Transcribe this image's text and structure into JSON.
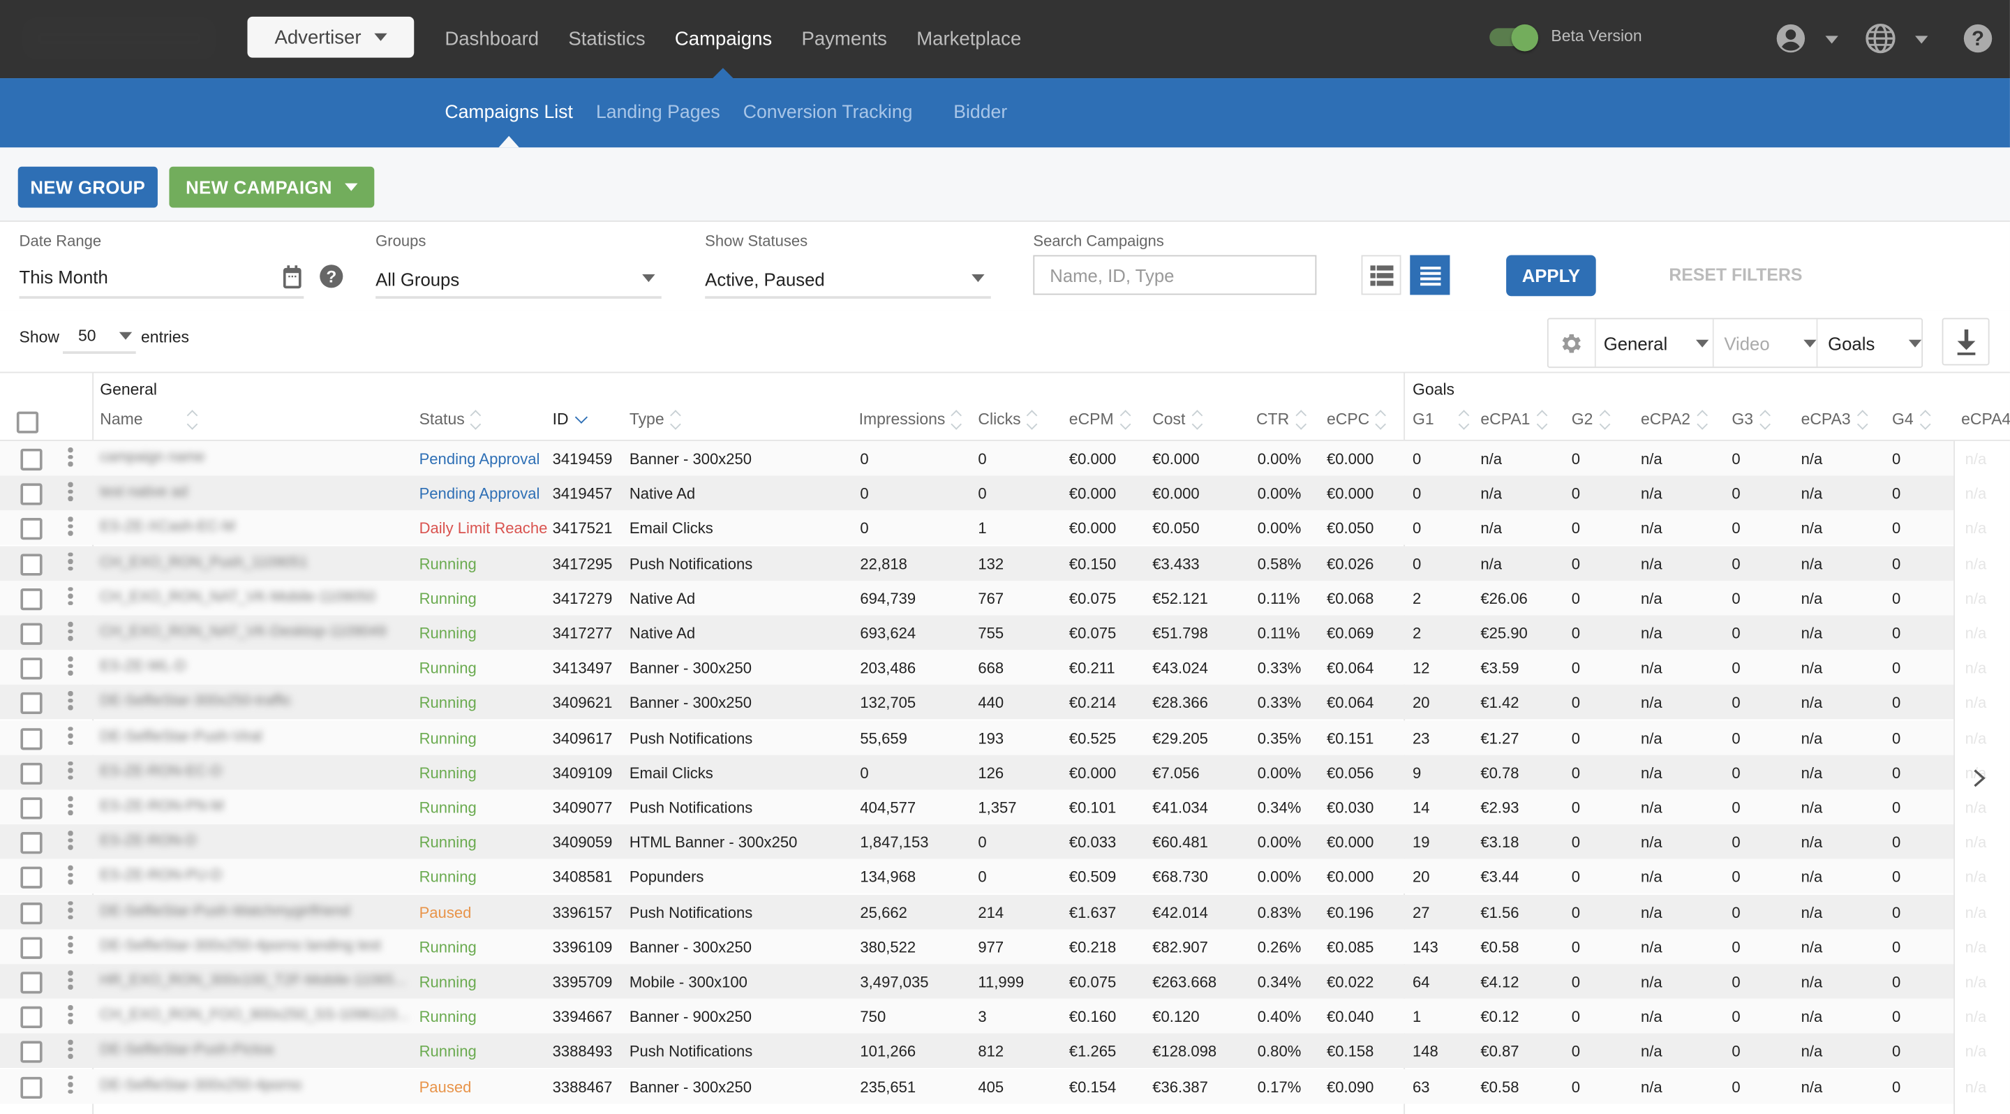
{
  "topnav": {
    "role_selector": "Advertiser",
    "items": [
      {
        "label": "Dashboard",
        "active": false
      },
      {
        "label": "Statistics",
        "active": false
      },
      {
        "label": "Campaigns",
        "active": true
      },
      {
        "label": "Payments",
        "active": false
      },
      {
        "label": "Marketplace",
        "active": false
      }
    ],
    "beta_label": "Beta Version",
    "beta_enabled": true
  },
  "subnav": {
    "items": [
      {
        "label": "Campaigns List",
        "active": true
      },
      {
        "label": "Landing Pages",
        "active": false
      },
      {
        "label": "Conversion Tracking",
        "active": false
      },
      {
        "label": "Bidder",
        "active": false
      }
    ]
  },
  "actions": {
    "new_group": "NEW GROUP",
    "new_campaign": "NEW CAMPAIGN"
  },
  "filters": {
    "date_range_label": "Date Range",
    "date_range_value": "This Month",
    "groups_label": "Groups",
    "groups_value": "All Groups",
    "statuses_label": "Show Statuses",
    "statuses_value": "Active, Paused",
    "search_label": "Search Campaigns",
    "search_placeholder": "Name, ID, Type",
    "search_value": "",
    "apply": "APPLY",
    "reset": "RESET FILTERS"
  },
  "entries": {
    "show": "Show",
    "count": "50",
    "suffix": "entries"
  },
  "column_sets": {
    "general": "General",
    "video": "Video",
    "goals": "Goals"
  },
  "table": {
    "group_general": "General",
    "group_goals": "Goals",
    "columns": {
      "name": "Name",
      "status": "Status",
      "id": "ID",
      "type": "Type",
      "impressions": "Impressions",
      "clicks": "Clicks",
      "ecpm": "eCPM",
      "cost": "Cost",
      "ctr": "CTR",
      "ecpc": "eCPC",
      "g1": "G1",
      "ecpa1": "eCPA1",
      "g2": "G2",
      "ecpa2": "eCPA2",
      "g3": "G3",
      "ecpa3": "eCPA3",
      "g4": "G4",
      "ecpa4": "eCPA4"
    },
    "sorted_by": "ID",
    "rows": [
      {
        "name": "campaign name",
        "status": "Pending Approval",
        "status_kind": "pending",
        "id": "3419459",
        "type": "Banner - 300x250",
        "impressions": "0",
        "clicks": "0",
        "ecpm": "€0.000",
        "cost": "€0.000",
        "ctr": "0.00%",
        "ecpc": "€0.000",
        "g1": "0",
        "ecpa1": "n/a",
        "g2": "0",
        "ecpa2": "n/a",
        "g3": "0",
        "ecpa3": "n/a",
        "g4": "0",
        "ecpa4": "n/a"
      },
      {
        "name": "test native ad",
        "status": "Pending Approval",
        "status_kind": "pending",
        "id": "3419457",
        "type": "Native Ad",
        "impressions": "0",
        "clicks": "0",
        "ecpm": "€0.000",
        "cost": "€0.000",
        "ctr": "0.00%",
        "ecpc": "€0.000",
        "g1": "0",
        "ecpa1": "n/a",
        "g2": "0",
        "ecpa2": "n/a",
        "g3": "0",
        "ecpa3": "n/a",
        "g4": "0",
        "ecpa4": "n/a"
      },
      {
        "name": "ES-ZE-XCash-EC-M",
        "status": "Daily Limit Reache",
        "status_kind": "limit",
        "id": "3417521",
        "type": "Email Clicks",
        "impressions": "0",
        "clicks": "1",
        "ecpm": "€0.000",
        "cost": "€0.050",
        "ctr": "0.00%",
        "ecpc": "€0.050",
        "g1": "0",
        "ecpa1": "n/a",
        "g2": "0",
        "ecpa2": "n/a",
        "g3": "0",
        "ecpa3": "n/a",
        "g4": "0",
        "ecpa4": "n/a"
      },
      {
        "name": "CH_EXO_RON_Push_1109051",
        "status": "Running",
        "status_kind": "running",
        "id": "3417295",
        "type": "Push Notifications",
        "impressions": "22,818",
        "clicks": "132",
        "ecpm": "€0.150",
        "cost": "€3.433",
        "ctr": "0.58%",
        "ecpc": "€0.026",
        "g1": "0",
        "ecpa1": "n/a",
        "g2": "0",
        "ecpa2": "n/a",
        "g3": "0",
        "ecpa3": "n/a",
        "g4": "0",
        "ecpa4": "n/a"
      },
      {
        "name": "CH_EXO_RON_NAT_VK-Mobile-1109050",
        "status": "Running",
        "status_kind": "running",
        "id": "3417279",
        "type": "Native Ad",
        "impressions": "694,739",
        "clicks": "767",
        "ecpm": "€0.075",
        "cost": "€52.121",
        "ctr": "0.11%",
        "ecpc": "€0.068",
        "g1": "2",
        "ecpa1": "€26.06",
        "g2": "0",
        "ecpa2": "n/a",
        "g3": "0",
        "ecpa3": "n/a",
        "g4": "0",
        "ecpa4": "n/a"
      },
      {
        "name": "CH_EXO_RON_NAT_VK-Desktop-1109049",
        "status": "Running",
        "status_kind": "running",
        "id": "3417277",
        "type": "Native Ad",
        "impressions": "693,624",
        "clicks": "755",
        "ecpm": "€0.075",
        "cost": "€51.798",
        "ctr": "0.11%",
        "ecpc": "€0.069",
        "g1": "2",
        "ecpa1": "€25.90",
        "g2": "0",
        "ecpa2": "n/a",
        "g3": "0",
        "ecpa3": "n/a",
        "g4": "0",
        "ecpa4": "n/a"
      },
      {
        "name": "ES-ZE-WL-D",
        "status": "Running",
        "status_kind": "running",
        "id": "3413497",
        "type": "Banner - 300x250",
        "impressions": "203,486",
        "clicks": "668",
        "ecpm": "€0.211",
        "cost": "€43.024",
        "ctr": "0.33%",
        "ecpc": "€0.064",
        "g1": "12",
        "ecpa1": "€3.59",
        "g2": "0",
        "ecpa2": "n/a",
        "g3": "0",
        "ecpa3": "n/a",
        "g4": "0",
        "ecpa4": "n/a"
      },
      {
        "name": "DE-SelfieStar-300x250-traffic",
        "status": "Running",
        "status_kind": "running",
        "id": "3409621",
        "type": "Banner - 300x250",
        "impressions": "132,705",
        "clicks": "440",
        "ecpm": "€0.214",
        "cost": "€28.366",
        "ctr": "0.33%",
        "ecpc": "€0.064",
        "g1": "20",
        "ecpa1": "€1.42",
        "g2": "0",
        "ecpa2": "n/a",
        "g3": "0",
        "ecpa3": "n/a",
        "g4": "0",
        "ecpa4": "n/a"
      },
      {
        "name": "DE-SelfieStar-Push-Viral",
        "status": "Running",
        "status_kind": "running",
        "id": "3409617",
        "type": "Push Notifications",
        "impressions": "55,659",
        "clicks": "193",
        "ecpm": "€0.525",
        "cost": "€29.205",
        "ctr": "0.35%",
        "ecpc": "€0.151",
        "g1": "23",
        "ecpa1": "€1.27",
        "g2": "0",
        "ecpa2": "n/a",
        "g3": "0",
        "ecpa3": "n/a",
        "g4": "0",
        "ecpa4": "n/a"
      },
      {
        "name": "ES-ZE-RON-EC-D",
        "status": "Running",
        "status_kind": "running",
        "id": "3409109",
        "type": "Email Clicks",
        "impressions": "0",
        "clicks": "126",
        "ecpm": "€0.000",
        "cost": "€7.056",
        "ctr": "0.00%",
        "ecpc": "€0.056",
        "g1": "9",
        "ecpa1": "€0.78",
        "g2": "0",
        "ecpa2": "n/a",
        "g3": "0",
        "ecpa3": "n/a",
        "g4": "0",
        "ecpa4": "n/a"
      },
      {
        "name": "ES-ZE-RON-PN-M",
        "status": "Running",
        "status_kind": "running",
        "id": "3409077",
        "type": "Push Notifications",
        "impressions": "404,577",
        "clicks": "1,357",
        "ecpm": "€0.101",
        "cost": "€41.034",
        "ctr": "0.34%",
        "ecpc": "€0.030",
        "g1": "14",
        "ecpa1": "€2.93",
        "g2": "0",
        "ecpa2": "n/a",
        "g3": "0",
        "ecpa3": "n/a",
        "g4": "0",
        "ecpa4": "n/a"
      },
      {
        "name": "ES-ZE-RON-D",
        "status": "Running",
        "status_kind": "running",
        "id": "3409059",
        "type": "HTML Banner - 300x250",
        "impressions": "1,847,153",
        "clicks": "0",
        "ecpm": "€0.033",
        "cost": "€60.481",
        "ctr": "0.00%",
        "ecpc": "€0.000",
        "g1": "19",
        "ecpa1": "€3.18",
        "g2": "0",
        "ecpa2": "n/a",
        "g3": "0",
        "ecpa3": "n/a",
        "g4": "0",
        "ecpa4": "n/a"
      },
      {
        "name": "ES-ZE-RON-PU-D",
        "status": "Running",
        "status_kind": "running",
        "id": "3408581",
        "type": "Popunders",
        "impressions": "134,968",
        "clicks": "0",
        "ecpm": "€0.509",
        "cost": "€68.730",
        "ctr": "0.00%",
        "ecpc": "€0.000",
        "g1": "20",
        "ecpa1": "€3.44",
        "g2": "0",
        "ecpa2": "n/a",
        "g3": "0",
        "ecpa3": "n/a",
        "g4": "0",
        "ecpa4": "n/a"
      },
      {
        "name": "DE-SelfieStar-Push-Watchmygirlfriend",
        "status": "Paused",
        "status_kind": "paused",
        "id": "3396157",
        "type": "Push Notifications",
        "impressions": "25,662",
        "clicks": "214",
        "ecpm": "€1.637",
        "cost": "€42.014",
        "ctr": "0.83%",
        "ecpc": "€0.196",
        "g1": "27",
        "ecpa1": "€1.56",
        "g2": "0",
        "ecpa2": "n/a",
        "g3": "0",
        "ecpa3": "n/a",
        "g4": "0",
        "ecpa4": "n/a"
      },
      {
        "name": "DE-SelfieStar-300x250-4porno landing test",
        "status": "Running",
        "status_kind": "running",
        "id": "3396109",
        "type": "Banner - 300x250",
        "impressions": "380,522",
        "clicks": "977",
        "ecpm": "€0.218",
        "cost": "€82.907",
        "ctr": "0.26%",
        "ecpc": "€0.085",
        "g1": "143",
        "ecpa1": "€0.58",
        "g2": "0",
        "ecpa2": "n/a",
        "g3": "0",
        "ecpa3": "n/a",
        "g4": "0",
        "ecpa4": "n/a"
      },
      {
        "name": "HR_EXO_RON_300x100_T2F-Mobile-11065...",
        "status": "Running",
        "status_kind": "running",
        "id": "3395709",
        "type": "Mobile - 300x100",
        "impressions": "3,497,035",
        "clicks": "11,999",
        "ecpm": "€0.075",
        "cost": "€263.668",
        "ctr": "0.34%",
        "ecpc": "€0.022",
        "g1": "64",
        "ecpa1": "€4.12",
        "g2": "0",
        "ecpa2": "n/a",
        "g3": "0",
        "ecpa3": "n/a",
        "g4": "0",
        "ecpa4": "n/a"
      },
      {
        "name": "CH_EXO_RON_FOO_900x250_SS-1096123...",
        "status": "Running",
        "status_kind": "running",
        "id": "3394667",
        "type": "Banner - 900x250",
        "impressions": "750",
        "clicks": "3",
        "ecpm": "€0.160",
        "cost": "€0.120",
        "ctr": "0.40%",
        "ecpc": "€0.040",
        "g1": "1",
        "ecpa1": "€0.12",
        "g2": "0",
        "ecpa2": "n/a",
        "g3": "0",
        "ecpa3": "n/a",
        "g4": "0",
        "ecpa4": "n/a"
      },
      {
        "name": "DE-SelfieStar-Push-Pictoa",
        "status": "Running",
        "status_kind": "running",
        "id": "3388493",
        "type": "Push Notifications",
        "impressions": "101,266",
        "clicks": "812",
        "ecpm": "€1.265",
        "cost": "€128.098",
        "ctr": "0.80%",
        "ecpc": "€0.158",
        "g1": "148",
        "ecpa1": "€0.87",
        "g2": "0",
        "ecpa2": "n/a",
        "g3": "0",
        "ecpa3": "n/a",
        "g4": "0",
        "ecpa4": "n/a"
      },
      {
        "name": "DE-SelfieStar-300x250-4porno",
        "status": "Paused",
        "status_kind": "paused",
        "id": "3388467",
        "type": "Banner - 300x250",
        "impressions": "235,651",
        "clicks": "405",
        "ecpm": "€0.154",
        "cost": "€36.387",
        "ctr": "0.17%",
        "ecpc": "€0.090",
        "g1": "63",
        "ecpa1": "€0.58",
        "g2": "0",
        "ecpa2": "n/a",
        "g3": "0",
        "ecpa3": "n/a",
        "g4": "0",
        "ecpa4": "n/a"
      }
    ]
  },
  "colors": {
    "topbar": "#333333",
    "brand_blue": "#2e6fb5",
    "green": "#72ad5c",
    "status_pending": "#2e6fb5",
    "status_limit": "#d9534f",
    "status_running": "#6aaa4f",
    "status_paused": "#e8944a"
  }
}
